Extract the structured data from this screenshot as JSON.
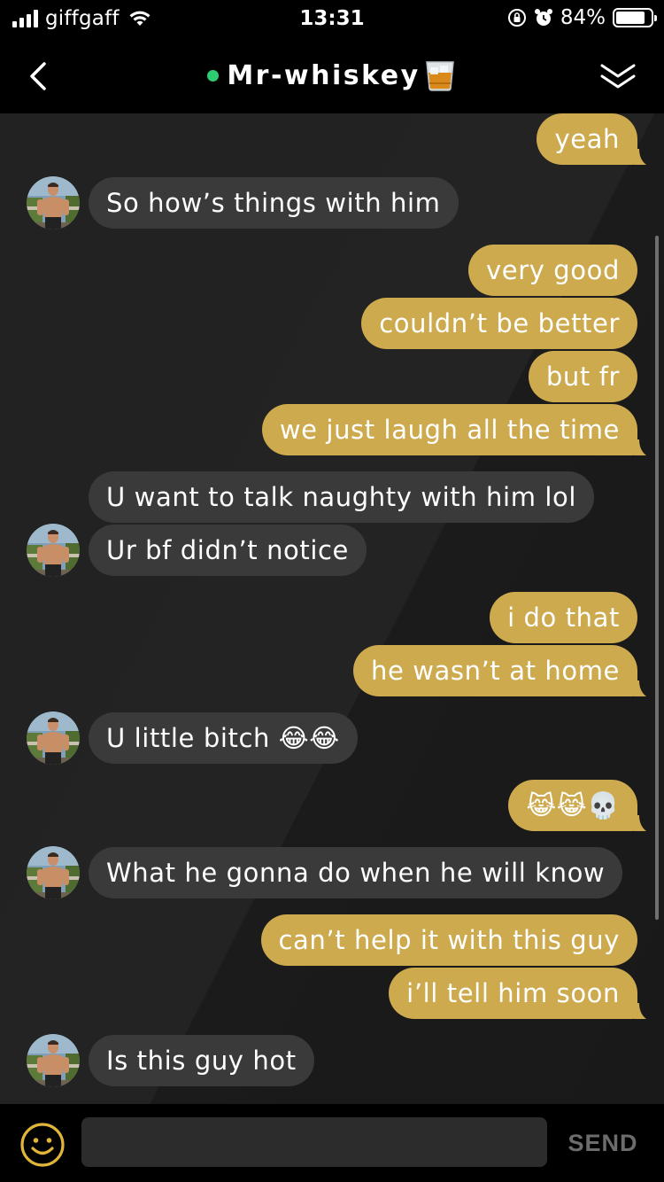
{
  "status_bar": {
    "carrier": "giffgaff",
    "time": "13:31",
    "battery_percent": "84%",
    "battery_level": 0.84,
    "icons": [
      "signal-icon",
      "wifi-icon",
      "orientation-lock-icon",
      "alarm-icon",
      "battery-icon"
    ]
  },
  "header": {
    "title": "Mr-whiskey",
    "title_emoji": "whiskey-glass-icon",
    "online_color": "#2ecc71",
    "back_icon": "chevron-left-icon",
    "collapse_icon": "double-chevron-down-icon"
  },
  "messages": [
    {
      "dir": "out",
      "text": "yeah"
    },
    {
      "dir": "in",
      "text": "So how’s things with him"
    },
    {
      "dir": "out",
      "text": "very good"
    },
    {
      "dir": "out",
      "text": "couldn’t be better"
    },
    {
      "dir": "out",
      "text": "but fr"
    },
    {
      "dir": "out",
      "text": "we just laugh all the time"
    },
    {
      "dir": "in",
      "text": "U want to talk naughty with him lol"
    },
    {
      "dir": "in",
      "text": "Ur bf didn’t notice"
    },
    {
      "dir": "out",
      "text": "i do that"
    },
    {
      "dir": "out",
      "text": "he wasn’t at home"
    },
    {
      "dir": "in",
      "text": "U little bitch 😂😂"
    },
    {
      "dir": "out",
      "text": "😹😹💀"
    },
    {
      "dir": "in",
      "text": "What he gonna do when he will know"
    },
    {
      "dir": "out",
      "text": "can’t help it with this guy"
    },
    {
      "dir": "out",
      "text": "i’ll tell him soon"
    },
    {
      "dir": "in",
      "text": "Is this guy hot"
    }
  ],
  "input": {
    "placeholder": "",
    "value": "",
    "send_label": "SEND",
    "emoji_icon": "smiley-icon"
  },
  "colors": {
    "outgoing_bubble": "#ceaa4f",
    "incoming_bubble": "#3a3a3a",
    "accent": "#e0b53a"
  }
}
